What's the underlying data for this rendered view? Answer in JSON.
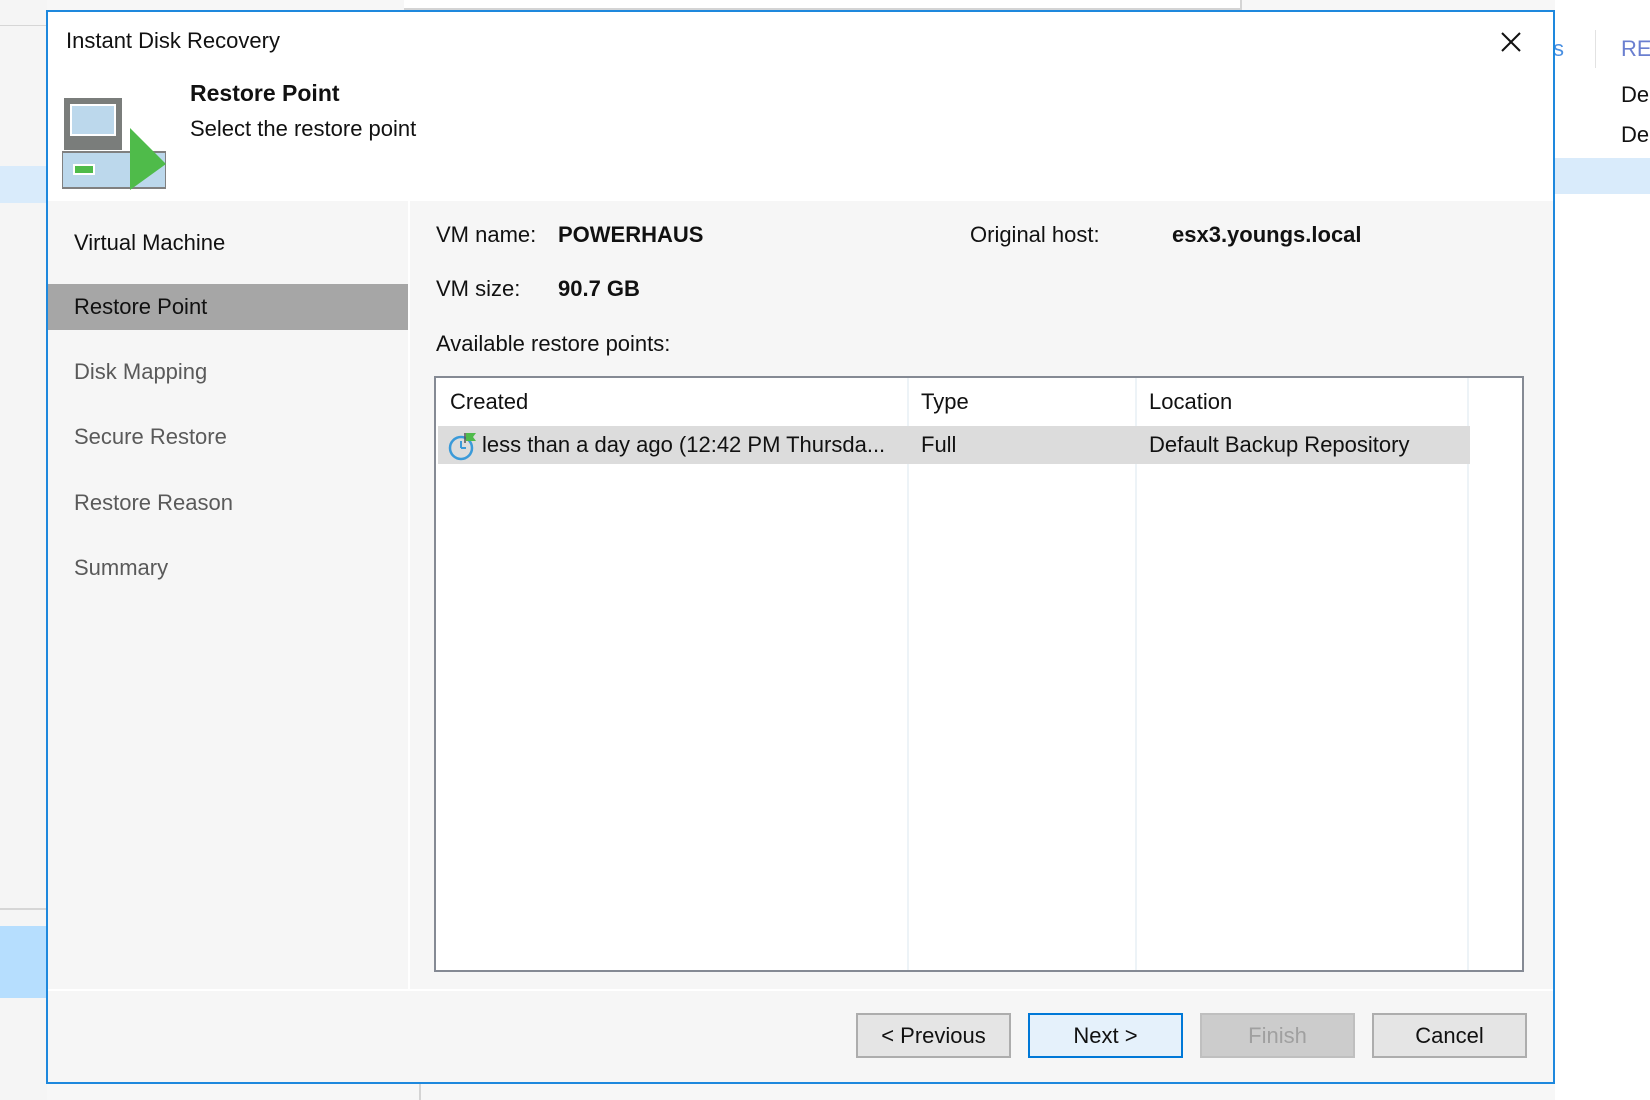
{
  "background": {
    "right_tab_fragment": "s",
    "right_header_fragment": "REI",
    "right_rows": [
      "De",
      "De"
    ]
  },
  "dialog": {
    "title": "Instant Disk Recovery",
    "close_icon": "close-icon",
    "header": {
      "icon": "disk-restore-icon",
      "step_title": "Restore Point",
      "step_subtitle": "Select the restore point"
    },
    "steps": [
      {
        "label": "Virtual Machine",
        "state": "done"
      },
      {
        "label": "Restore Point",
        "state": "active"
      },
      {
        "label": "Disk Mapping",
        "state": "pending"
      },
      {
        "label": "Secure Restore",
        "state": "pending"
      },
      {
        "label": "Restore Reason",
        "state": "pending"
      },
      {
        "label": "Summary",
        "state": "pending"
      }
    ],
    "vm_info": {
      "name_label": "VM name:",
      "name_value": "POWERHAUS",
      "size_label": "VM size:",
      "size_value": "90.7 GB",
      "host_label": "Original host:",
      "host_value": "esx3.youngs.local"
    },
    "restore_points": {
      "label": "Available restore points:",
      "columns": [
        "Created",
        "Type",
        "Location"
      ],
      "rows": [
        {
          "icon": "restore-point-clock-flag-icon",
          "created": "less than a day ago (12:42 PM Thursda...",
          "type": "Full",
          "location": "Default Backup Repository",
          "selected": true
        }
      ]
    },
    "buttons": {
      "previous": "< Previous",
      "next": "Next >",
      "finish": "Finish",
      "cancel": "Cancel"
    },
    "colors": {
      "accent_border": "#1e88dd",
      "selected_step": "#a6a6a6",
      "selected_row": "#dcdcdc",
      "icon_green": "#4fbb4a"
    }
  }
}
